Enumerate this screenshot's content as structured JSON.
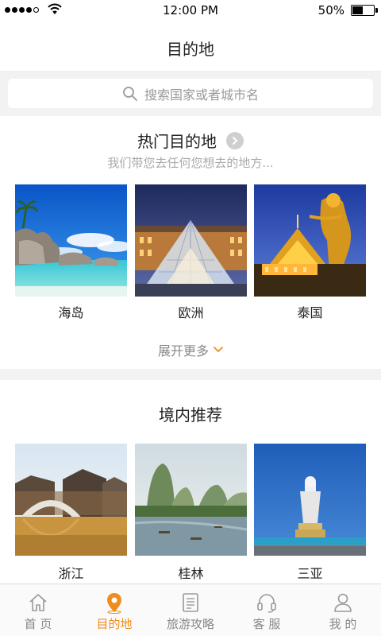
{
  "status_bar": {
    "time": "12:00 PM",
    "battery": "50%",
    "battery_level": 0.5
  },
  "header": {
    "title": "目的地"
  },
  "search": {
    "placeholder": "搜索国家或者城市名",
    "icon": "search-icon"
  },
  "hot_section": {
    "title": "热门目的地",
    "subtitle": "我们带您去任何您想去的地方...",
    "items": [
      {
        "label": "海岛"
      },
      {
        "label": "欧洲"
      },
      {
        "label": "泰国"
      }
    ],
    "expand_label": "展开更多"
  },
  "domestic_section": {
    "title": "境内推荐",
    "items": [
      {
        "label": "浙江"
      },
      {
        "label": "桂林"
      },
      {
        "label": "三亚"
      }
    ]
  },
  "tab_bar": {
    "items": [
      {
        "label": "首 页",
        "icon": "home-icon"
      },
      {
        "label": "目的地",
        "icon": "location-pin-icon",
        "active": true
      },
      {
        "label": "旅游攻略",
        "icon": "document-icon"
      },
      {
        "label": "客 服",
        "icon": "headset-icon"
      },
      {
        "label": "我 的",
        "icon": "user-icon"
      }
    ]
  },
  "colors": {
    "accent": "#f08c1a"
  }
}
